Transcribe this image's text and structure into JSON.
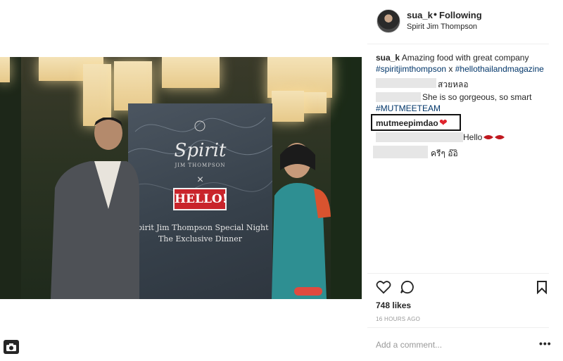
{
  "post": {
    "username": "sua_k",
    "separator": "•",
    "follow_status": "Following",
    "location": "Spirit Jim Thompson",
    "caption_user": "sua_k",
    "caption_text": "Amazing food with great company",
    "hashtag_1": "#spiritjimthompson",
    "hashtag_join": " x ",
    "hashtag_2": "#hellothailandmagazine"
  },
  "photo": {
    "banner_brand": "Spirit",
    "banner_brand_sub": "JIM THOMPSON",
    "banner_x": "×",
    "banner_logo": "HELLO!",
    "banner_line_1": "Spirit Jim Thompson Special Night",
    "banner_line_2": "The Exclusive Dinner"
  },
  "comments": [
    {
      "text": "สวยหลอ"
    },
    {
      "text": "She is so gorgeous, so smart"
    },
    {
      "text": "#MUTMEETEAM"
    },
    {
      "user": "mutmeepimdao",
      "emoji": "❤"
    },
    {
      "text": "Hello"
    },
    {
      "text": "ครีๆ อ๊อิ"
    }
  ],
  "actions": {
    "likes": "748 likes",
    "time": "16 HOURS AGO",
    "comment_placeholder": "Add a comment...",
    "more": "•••"
  },
  "colors": {
    "accent_red": "#e0242d",
    "hashtag_blue": "#003569",
    "muted_gray": "#999999"
  }
}
